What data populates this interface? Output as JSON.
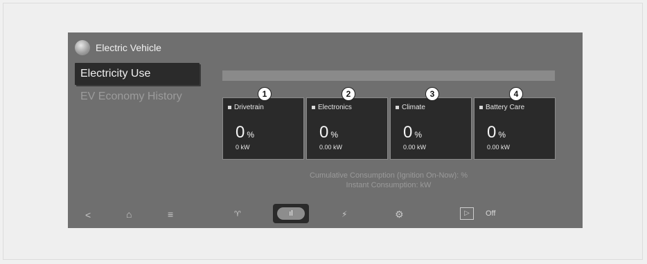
{
  "header": {
    "title": "Electric Vehicle",
    "logo_icon": "globe-icon"
  },
  "menu": {
    "active": "Electricity Use",
    "items": [
      "EV Economy History"
    ]
  },
  "cards": [
    {
      "badge": "1",
      "label": "Drivetrain",
      "percent": "0",
      "unit": "%",
      "kw": "0 kW"
    },
    {
      "badge": "2",
      "label": "Electronics",
      "percent": "0",
      "unit": "%",
      "kw": "0.00 kW"
    },
    {
      "badge": "3",
      "label": "Climate",
      "percent": "0",
      "unit": "%",
      "kw": "0.00 kW"
    },
    {
      "badge": "4",
      "label": "Battery Care",
      "percent": "0",
      "unit": "%",
      "kw": "0.00 kW"
    }
  ],
  "summary": {
    "line1": "Cumulative Consumption (Ignition On-Now): %",
    "line2": "Instant Consumption: kW"
  },
  "nav": {
    "back": "<",
    "home": "⌂",
    "menu": "≡",
    "eco": "♈",
    "chart": "ıl",
    "charge": "⚡",
    "settings": "⚙",
    "play": "▷",
    "off_label": "Off"
  }
}
